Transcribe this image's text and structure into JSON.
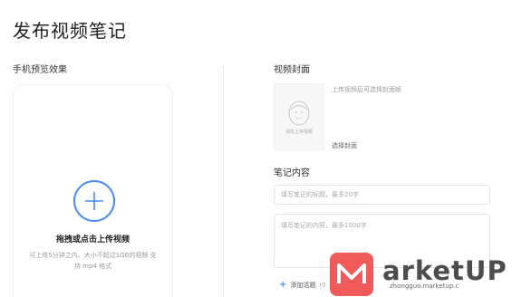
{
  "page": {
    "title": "发布视频笔记"
  },
  "left": {
    "section_label": "手机预览效果",
    "upload_title": "拖拽或点击上传视频",
    "upload_hint": "可上传5分钟之内、大小不超过1GB的视频 支持 mp4 格式"
  },
  "right": {
    "cover_label": "视频封面",
    "cover_placeholder": "请先上传视频",
    "cover_hint": "上传视频后可选择封面帧",
    "cover_select": "选择封面",
    "notes_label": "笔记内容",
    "title_placeholder": "填写笔记的标题，最多20字",
    "content_placeholder": "填写笔记的内容，最多1000字",
    "add_topic_label": "添加话题",
    "add_topic_hint": "(0"
  },
  "watermark": {
    "brand": "arketUP",
    "sub": "zhongguo.marketup.c"
  },
  "colors": {
    "accent": "#4b8cf5",
    "watermark": "#f05a5a"
  }
}
